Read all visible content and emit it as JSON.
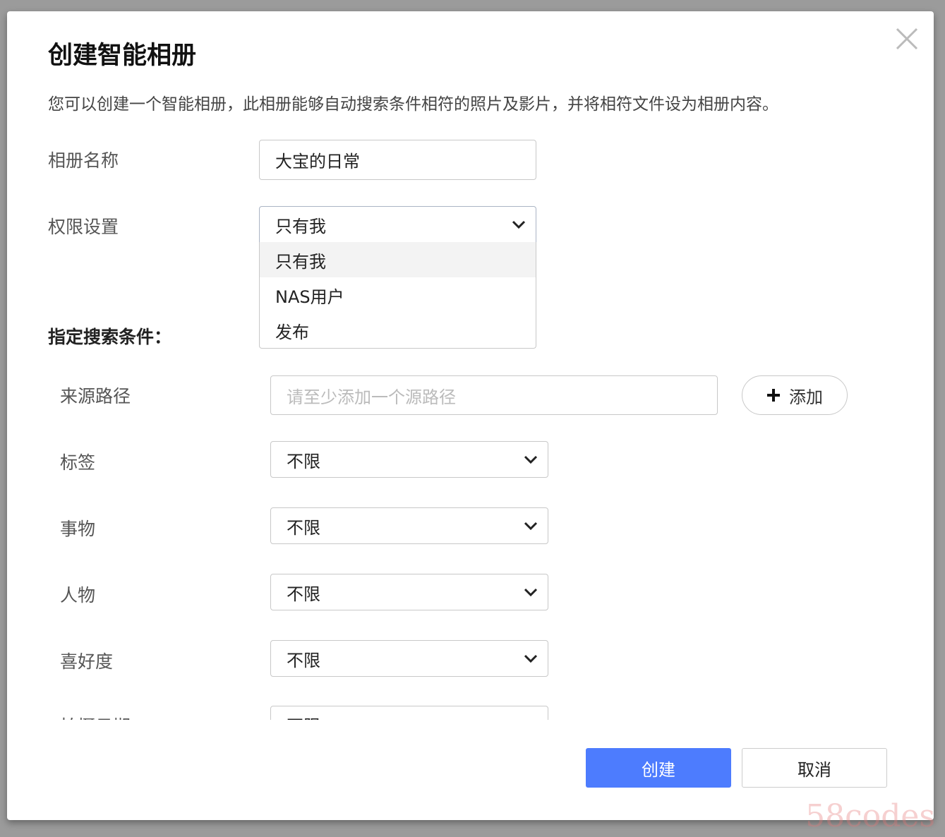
{
  "dialog": {
    "title": "创建智能相册",
    "description": "您可以创建一个智能相册，此相册能够自动搜索条件相符的照片及影片，并将相符文件设为相册内容。",
    "album_name": {
      "label": "相册名称",
      "value": "大宝的日常"
    },
    "permission": {
      "label": "权限设置",
      "value": "只有我",
      "options": [
        "只有我",
        "NAS用户",
        "发布"
      ],
      "highlighted": "只有我"
    },
    "section_title": "指定搜索条件：",
    "source": {
      "label": "来源路径",
      "placeholder": "请至少添加一个源路径",
      "add_label": "添加"
    },
    "filters": [
      {
        "label": "标签",
        "value": "不限"
      },
      {
        "label": "事物",
        "value": "不限"
      },
      {
        "label": "人物",
        "value": "不限"
      },
      {
        "label": "喜好度",
        "value": "不限"
      },
      {
        "label": "拍摄日期",
        "value": "不限"
      }
    ],
    "create_label": "创建",
    "cancel_label": "取消"
  },
  "watermark": "58codes",
  "colors": {
    "primary": "#4d7cfe"
  }
}
